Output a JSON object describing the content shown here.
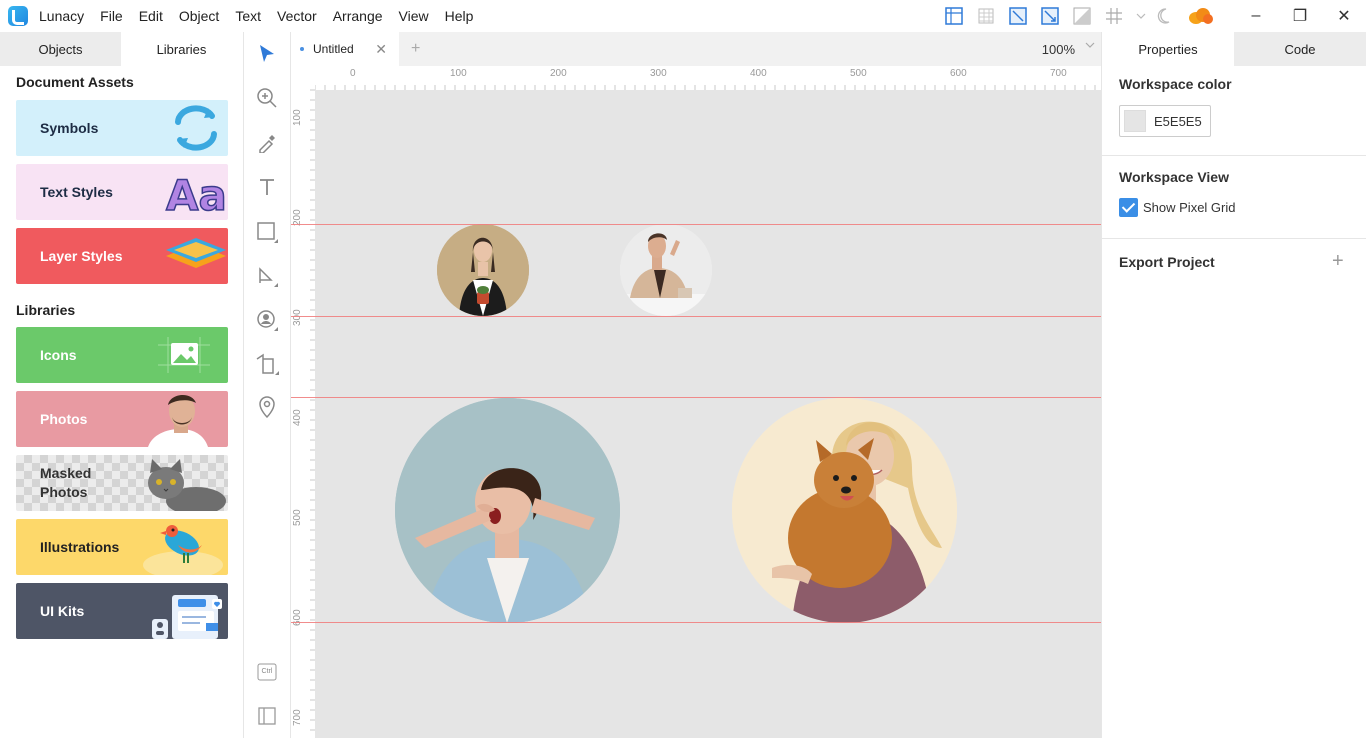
{
  "app": {
    "name": "Lunacy",
    "menu": [
      "File",
      "Edit",
      "Object",
      "Text",
      "Vector",
      "Arrange",
      "View",
      "Help"
    ]
  },
  "window_controls": {
    "minimize": "–",
    "restore": "❐",
    "close": "✕"
  },
  "left_panel": {
    "tabs": [
      "Objects",
      "Libraries"
    ],
    "active_tab": "Libraries",
    "document_assets_title": "Document Assets",
    "document_assets": [
      {
        "label": "Symbols",
        "bg": "#d3f0fb",
        "icon": "symbols-refresh-icon"
      },
      {
        "label": "Text Styles",
        "bg": "#f8e3f4",
        "icon": "text-styles-aa-icon"
      },
      {
        "label": "Layer Styles",
        "bg": "#f05a5e",
        "icon": "layer-styles-stack-icon"
      }
    ],
    "libraries_title": "Libraries",
    "libraries": [
      {
        "label": "Icons",
        "bg": "#6bc96a",
        "icon": "image-icon"
      },
      {
        "label": "Photos",
        "bg": "#e89aa2",
        "icon": "man-photo-thumbnail"
      },
      {
        "label": "Masked Photos",
        "bg": "#e6e6e6",
        "icon": "cat-thumbnail"
      },
      {
        "label": "Illustrations",
        "bg": "#fdd86a",
        "icon": "bird-illustration"
      },
      {
        "label": "UI Kits",
        "bg": "#4e5566",
        "icon": "ui-kit-thumbnail"
      }
    ]
  },
  "doc_tabs": {
    "active": "Untitled",
    "close": "✕",
    "add": "+",
    "zoom": "100%"
  },
  "ruler": {
    "top_labels": [
      "0",
      "100",
      "200",
      "300",
      "400",
      "500",
      "600",
      "700"
    ],
    "left_labels": [
      "100",
      "200",
      "300",
      "400",
      "500",
      "600",
      "700"
    ]
  },
  "tools_shortcut": "Ctrl",
  "right_panel": {
    "tabs": [
      "Properties",
      "Code"
    ],
    "active_tab": "Properties",
    "workspace_color_title": "Workspace color",
    "workspace_color_value": "E5E5E5",
    "workspace_view_title": "Workspace View",
    "show_pixel_grid_label": "Show Pixel Grid",
    "show_pixel_grid_checked": true,
    "export_project_title": "Export Project",
    "export_plus": "+"
  },
  "colors": {
    "canvas": "#e5e5e5",
    "accent": "#3a8ee6",
    "guide": "#f08080"
  }
}
